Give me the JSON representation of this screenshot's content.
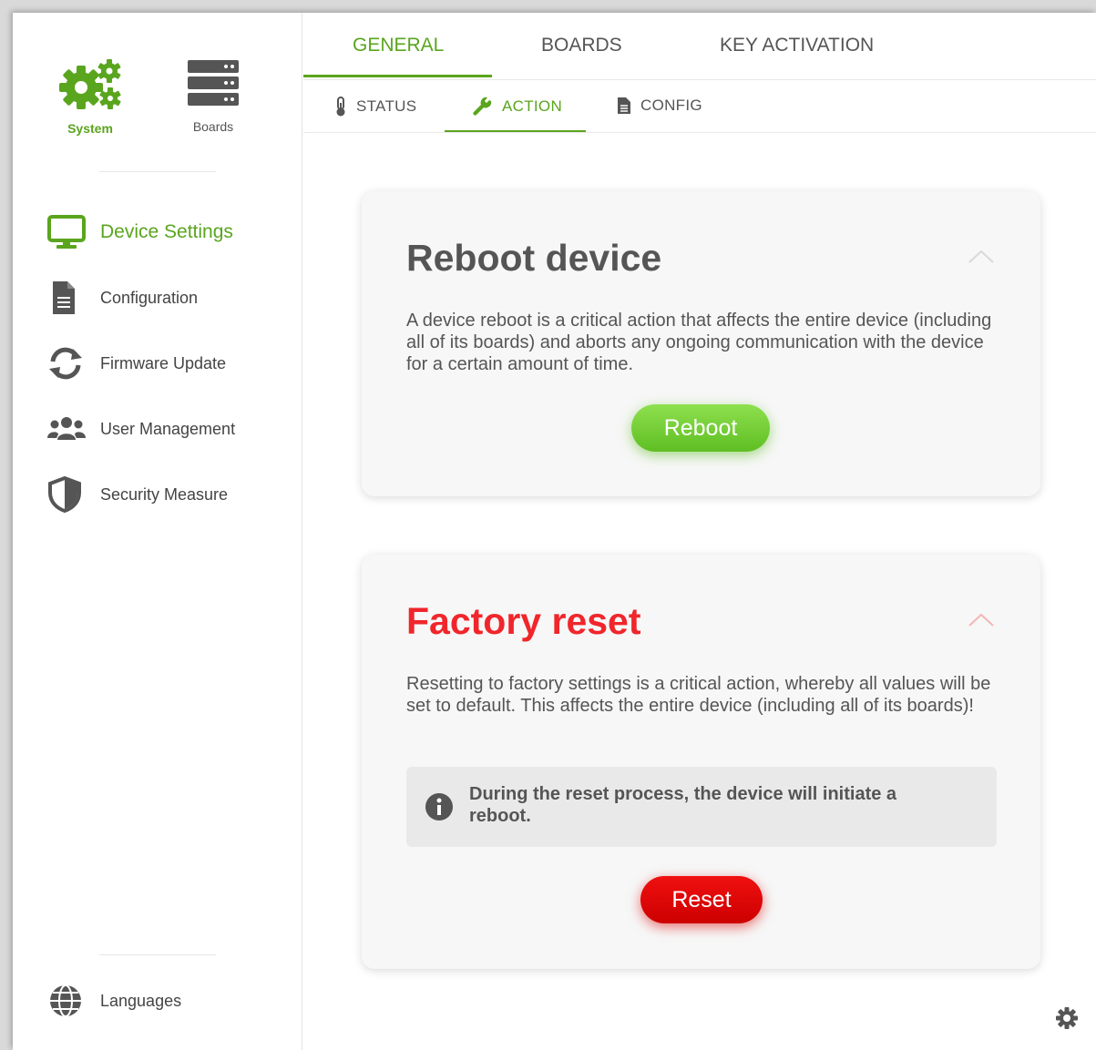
{
  "top_switch": {
    "system_label": "System",
    "boards_label": "Boards"
  },
  "sidebar": {
    "items": [
      {
        "label": "Device Settings",
        "icon": "monitor-icon",
        "active": true
      },
      {
        "label": "Configuration",
        "icon": "document-icon"
      },
      {
        "label": "Firmware Update",
        "icon": "refresh-icon"
      },
      {
        "label": "User Management",
        "icon": "users-icon"
      },
      {
        "label": "Security Measure",
        "icon": "shield-icon"
      }
    ],
    "languages_label": "Languages"
  },
  "tabs": [
    {
      "label": "GENERAL",
      "active": true
    },
    {
      "label": "BOARDS"
    },
    {
      "label": "KEY ACTIVATION"
    }
  ],
  "subtabs": [
    {
      "label": "STATUS",
      "icon": "thermometer-icon"
    },
    {
      "label": "ACTION",
      "icon": "wrench-icon",
      "active": true
    },
    {
      "label": "CONFIG",
      "icon": "file-icon"
    }
  ],
  "reboot_card": {
    "title": "Reboot device",
    "description": "A device reboot is a critical action that affects the entire device (including all of its boards) and aborts any ongoing communication with the device for a certain amount of time.",
    "button": "Reboot"
  },
  "reset_card": {
    "title": "Factory reset",
    "description": "Resetting to factory settings is a critical action, whereby all values will be set to default. This affects the entire device (including all of its boards)!",
    "info": "During the reset process, the device will initiate a reboot.",
    "button": "Reset"
  },
  "colors": {
    "accent": "#5aa51e",
    "danger": "#f0262b",
    "button_green": "#6fcb30",
    "button_red": "#e00000"
  }
}
